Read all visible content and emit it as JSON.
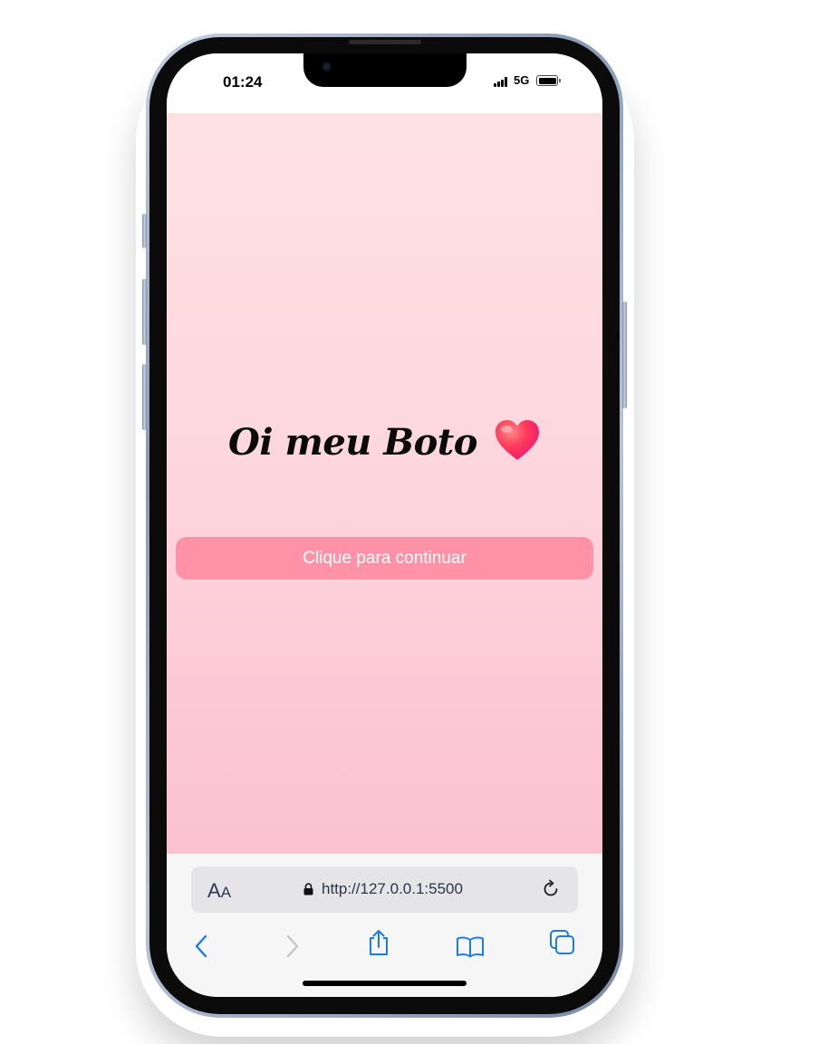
{
  "status_bar": {
    "time": "01:24",
    "network": "5G",
    "icons": [
      "signal-icon",
      "battery-icon"
    ]
  },
  "page": {
    "greeting": "Oi meu Boto",
    "greeting_emoji_icon": "heart-icon",
    "continue_button_label": "Clique para continuar",
    "colors": {
      "background_top": "#fee2e3",
      "background_bottom": "#fcc1d1",
      "button": "#ff92a6",
      "button_text": "#ffffff"
    }
  },
  "browser": {
    "text_size_label": "A",
    "text_size_label_small": "A",
    "url": "http://127.0.0.1:5500",
    "icons": [
      "lock-icon",
      "reload-icon",
      "back-icon",
      "forward-icon",
      "share-icon",
      "bookmarks-icon",
      "tabs-icon"
    ],
    "accent": "#1a7ce6"
  }
}
